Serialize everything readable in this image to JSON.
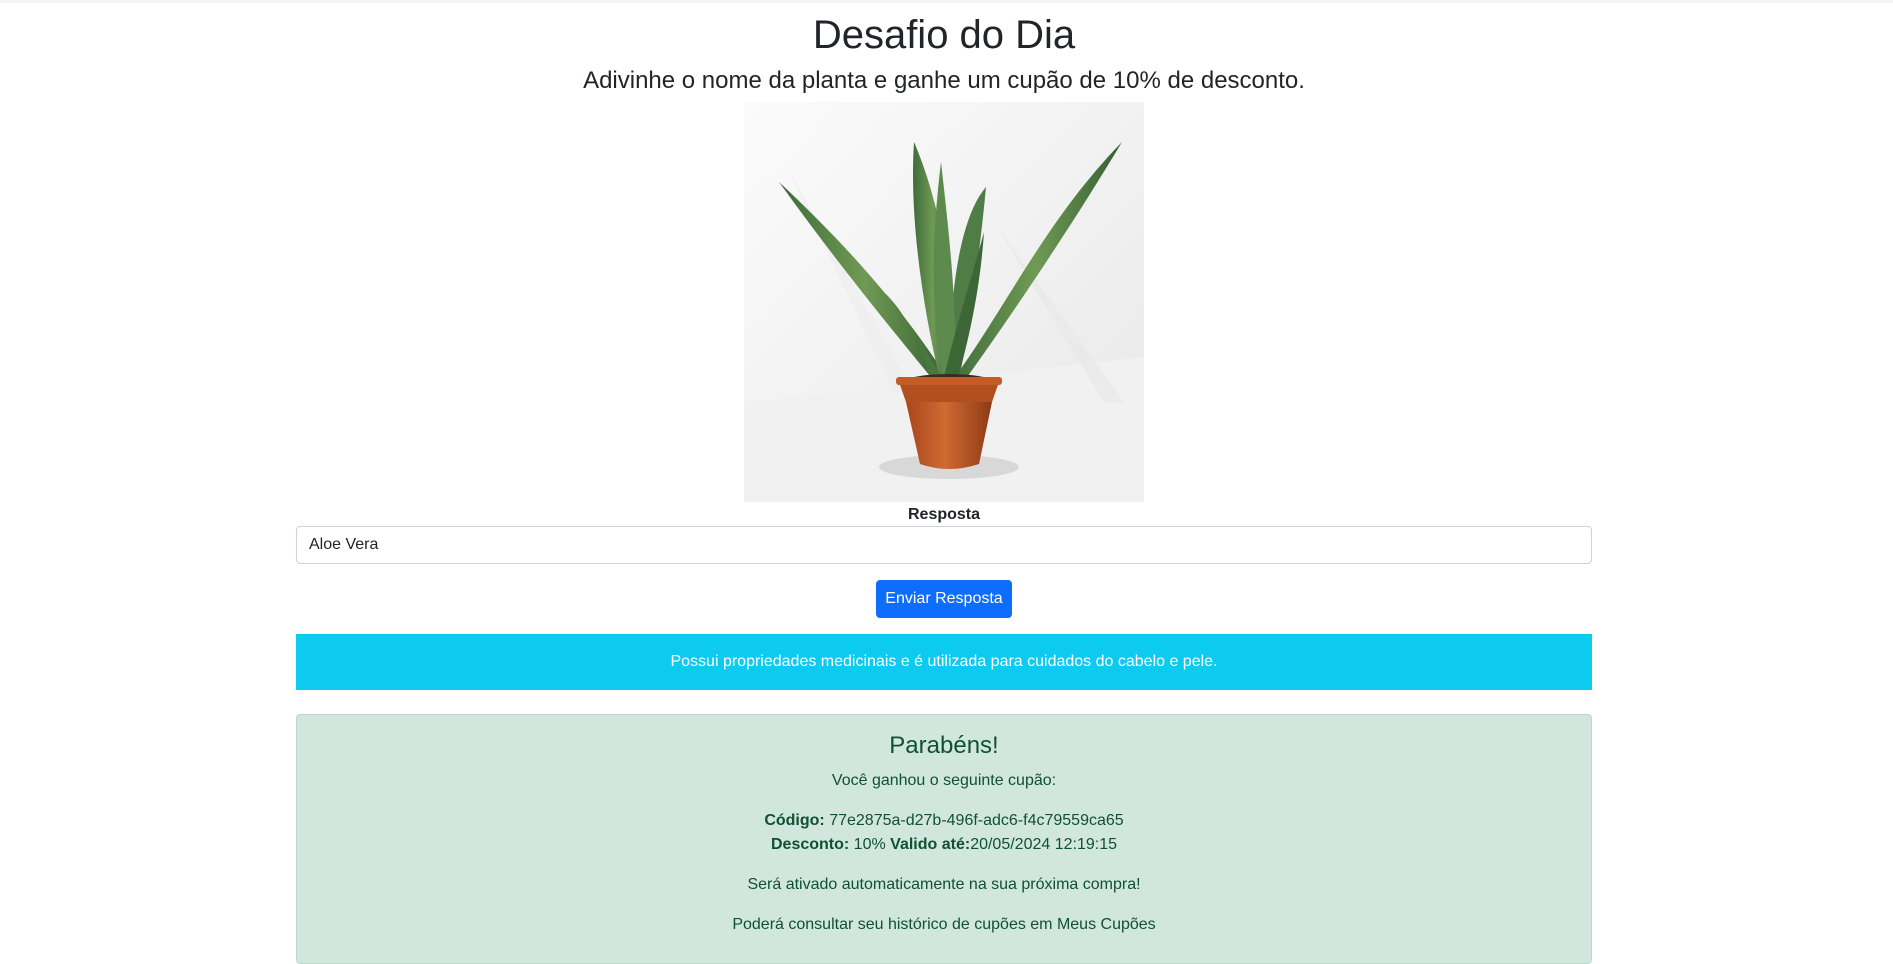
{
  "header": {
    "title": "Desafio do Dia",
    "subtitle": "Adivinhe o nome da planta e ganhe um cupão de 10% de desconto."
  },
  "challenge": {
    "image_icon": "aloe-vera-plant-photo",
    "answer_label": "Resposta",
    "answer_value": "Aloe Vera",
    "submit_label": "Enviar Resposta"
  },
  "hint": {
    "text": "Possui propriedades medicinais e é utilizada para cuidados do cabelo e pele."
  },
  "result": {
    "title": "Parabéns!",
    "intro": "Você ganhou o seguinte cupão:",
    "code_label": "Código:",
    "code_value": "77e2875a-d27b-496f-adc6-f4c79559ca65",
    "discount_label": "Desconto:",
    "discount_value": "10%",
    "valid_label": "Valido até:",
    "valid_value": "20/05/2024 12:19:15",
    "activation_note": "Será ativado automaticamente na sua próxima compra!",
    "history_note": "Poderá consultar seu histórico de cupões em Meus Cupões"
  },
  "colors": {
    "primary": "#0d6efd",
    "info": "#0dcaf0",
    "success_bg": "#d1e7dd",
    "success_text": "#0f5132"
  }
}
